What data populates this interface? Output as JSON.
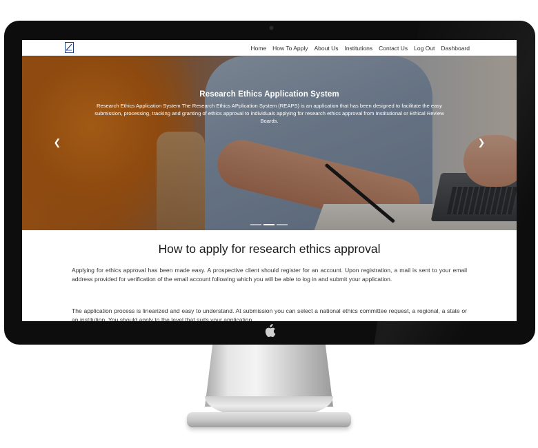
{
  "navbar": {
    "logo_icon": "brand-logo-icon",
    "links": [
      {
        "label": "Home"
      },
      {
        "label": "How To Apply"
      },
      {
        "label": "About Us"
      },
      {
        "label": "Institutions"
      },
      {
        "label": "Contact Us"
      },
      {
        "label": "Log Out"
      },
      {
        "label": "Dashboard"
      }
    ]
  },
  "hero": {
    "title": "Research Ethics Application System",
    "text": "Research Ethics Application System The Research Ethics APplication System (REAPS) is an application that has been designed to facilitate the easy submission, processing, tracking and granting of ethics approval to individuals applying for research ethics approval from Institutional or Ethical Review Boards.",
    "prev_icon": "chevron-left-icon",
    "next_icon": "chevron-right-icon",
    "slide_count": 3,
    "active_slide": 2
  },
  "content": {
    "title": "How to apply for research ethics approval",
    "paragraphs": [
      "Applying for ethics approval has been made easy. A prospective client should register for an account. Upon registration, a mail is sent to your email address provided for verification of the email account following which you will be able to log in and submit your application.",
      "The application process is linearized and easy to understand. At submission you can select a national ethics committee request, a regional, a state or an institution. You should apply to the level that suits your application."
    ]
  },
  "device": {
    "type": "desktop-monitor",
    "logo_icon": "apple-logo-icon"
  },
  "colors": {
    "bezel": "#0d0d0d",
    "nav_text": "#2b2b2b",
    "logo_blue": "#1f3d7a",
    "hero_orange": "#c7691a"
  }
}
